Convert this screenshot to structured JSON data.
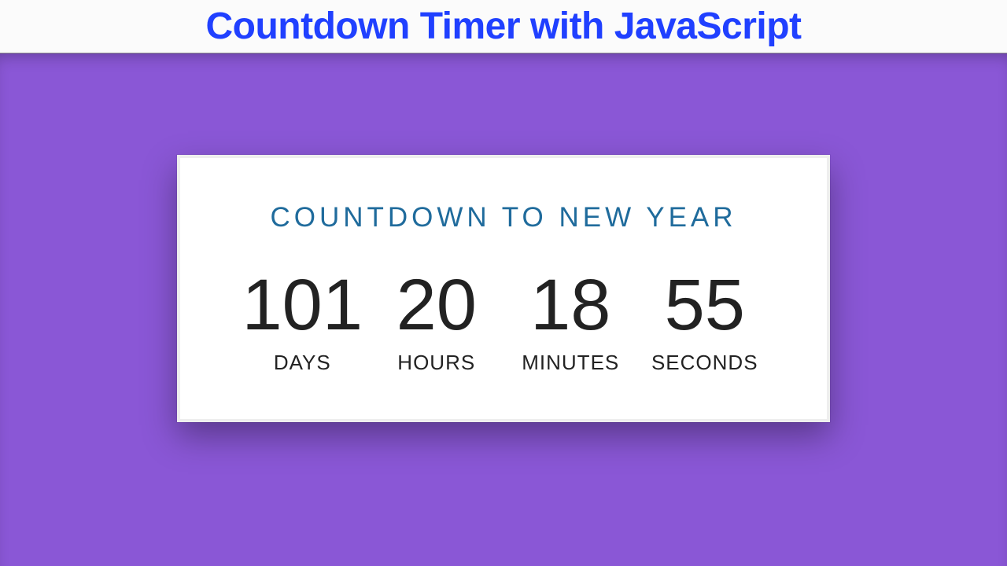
{
  "header": {
    "title": "Countdown Timer with JavaScript"
  },
  "card": {
    "title": "COUNTDOWN TO NEW YEAR"
  },
  "countdown": {
    "days": {
      "value": "101",
      "label": "DAYS"
    },
    "hours": {
      "value": "20",
      "label": "HOURS"
    },
    "minutes": {
      "value": "18",
      "label": "MINUTES"
    },
    "seconds": {
      "value": "55",
      "label": "SECONDS"
    }
  }
}
